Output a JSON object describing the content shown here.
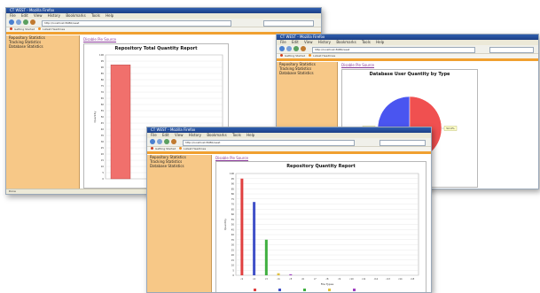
{
  "windows": [
    {
      "id": "w1",
      "title": "CT WEST - Mozilla Firefox",
      "menu": [
        "File",
        "Edit",
        "View",
        "History",
        "Bookmarks",
        "Tools",
        "Help"
      ],
      "url": "http://localhost:8080/west",
      "bookmarks": [
        "Getting Started",
        "Latest Headlines"
      ],
      "sidebar": [
        "Repository Statistics",
        "Tracking Statistics",
        "Database Statistics"
      ],
      "disable_link": "Disable Pie Source",
      "chart_title": "Repository Total Quantity Report",
      "status": "Done"
    },
    {
      "id": "w2",
      "title": "CT WEST - Mozilla Firefox",
      "menu": [
        "File",
        "Edit",
        "View",
        "History",
        "Bookmarks",
        "Tools",
        "Help"
      ],
      "url": "http://localhost:8080/west",
      "bookmarks": [
        "Getting Started",
        "Latest Headlines"
      ],
      "sidebar": [
        "Repository Statistics",
        "Tracking Statistics",
        "Database Statistics"
      ],
      "disable_link": "Disable Pie Source",
      "chart_title": "Database User Quantity by Type",
      "pie_labels": [
        "48.0%",
        "52.0%"
      ]
    },
    {
      "id": "w3",
      "title": "CT WEST - Mozilla Firefox",
      "menu": [
        "File",
        "Edit",
        "View",
        "History",
        "Bookmarks",
        "Tools",
        "Help"
      ],
      "url": "http://localhost:8080/west",
      "bookmarks": [
        "Getting Started",
        "Latest Headlines"
      ],
      "sidebar": [
        "Repository Statistics",
        "Tracking Statistics",
        "Database Statistics"
      ],
      "disable_link": "Disable Pie Source",
      "chart_title": "Repository Quantity Report"
    }
  ],
  "chart_data": [
    {
      "type": "bar",
      "title": "Repository Total Quantity Report",
      "categories": [
        "total"
      ],
      "values": [
        92
      ],
      "ylabel": "Quantity",
      "ylim": [
        0,
        100
      ],
      "ticks": [
        "100",
        "95",
        "90",
        "85",
        "80",
        "75",
        "70",
        "65",
        "60",
        "55",
        "50",
        "45",
        "40",
        "35",
        "30",
        "25",
        "20",
        "15",
        "10",
        "5",
        "0"
      ],
      "colors": [
        "#f0706c"
      ],
      "grid": true
    },
    {
      "type": "pie",
      "title": "Database User Quantity by Type",
      "values": [
        48,
        52
      ],
      "labels": [
        "48.0%",
        "52.0%"
      ],
      "colors": [
        "#4a55f0",
        "#f05050"
      ]
    },
    {
      "type": "bar",
      "title": "Repository Quantity Report",
      "categories": [
        "c1",
        "c2",
        "c3",
        "c4",
        "c5",
        "c6",
        "c7",
        "c8",
        "c9",
        "c10",
        "c11",
        "c12",
        "c13",
        "c14",
        "c15"
      ],
      "series": [
        {
          "values": [
            95,
            0,
            0,
            0,
            0,
            0,
            0,
            0,
            0,
            0,
            0,
            0,
            0,
            0,
            0
          ],
          "color": "#e04040"
        },
        {
          "values": [
            0,
            72,
            0,
            0,
            0,
            0,
            0,
            0,
            0,
            0,
            0,
            0,
            0,
            0,
            0
          ],
          "color": "#4050c8"
        },
        {
          "values": [
            0,
            0,
            35,
            0,
            0,
            0,
            0,
            0,
            0,
            0,
            0,
            0,
            0,
            0,
            0
          ],
          "color": "#40b040"
        },
        {
          "values": [
            0,
            0,
            0,
            2,
            0,
            0,
            0,
            0,
            0,
            0,
            0,
            0,
            0,
            0,
            0
          ],
          "color": "#e0c040"
        },
        {
          "values": [
            0,
            0,
            0,
            0,
            1,
            0,
            0,
            0,
            0,
            0,
            0,
            0,
            0,
            0,
            0
          ],
          "color": "#a040c0"
        }
      ],
      "ylabel": "Quantity",
      "xlabel": "File Types",
      "ylim": [
        0,
        100
      ],
      "ticks": [
        "100",
        "95",
        "90",
        "85",
        "80",
        "75",
        "70",
        "65",
        "60",
        "55",
        "50",
        "45",
        "40",
        "35",
        "30",
        "25",
        "20",
        "15",
        "10",
        "5",
        "0"
      ],
      "grid": true
    }
  ],
  "icons": {
    "back": "back-arrow-icon",
    "forward": "forward-arrow-icon",
    "reload": "reload-icon",
    "home": "home-icon"
  }
}
